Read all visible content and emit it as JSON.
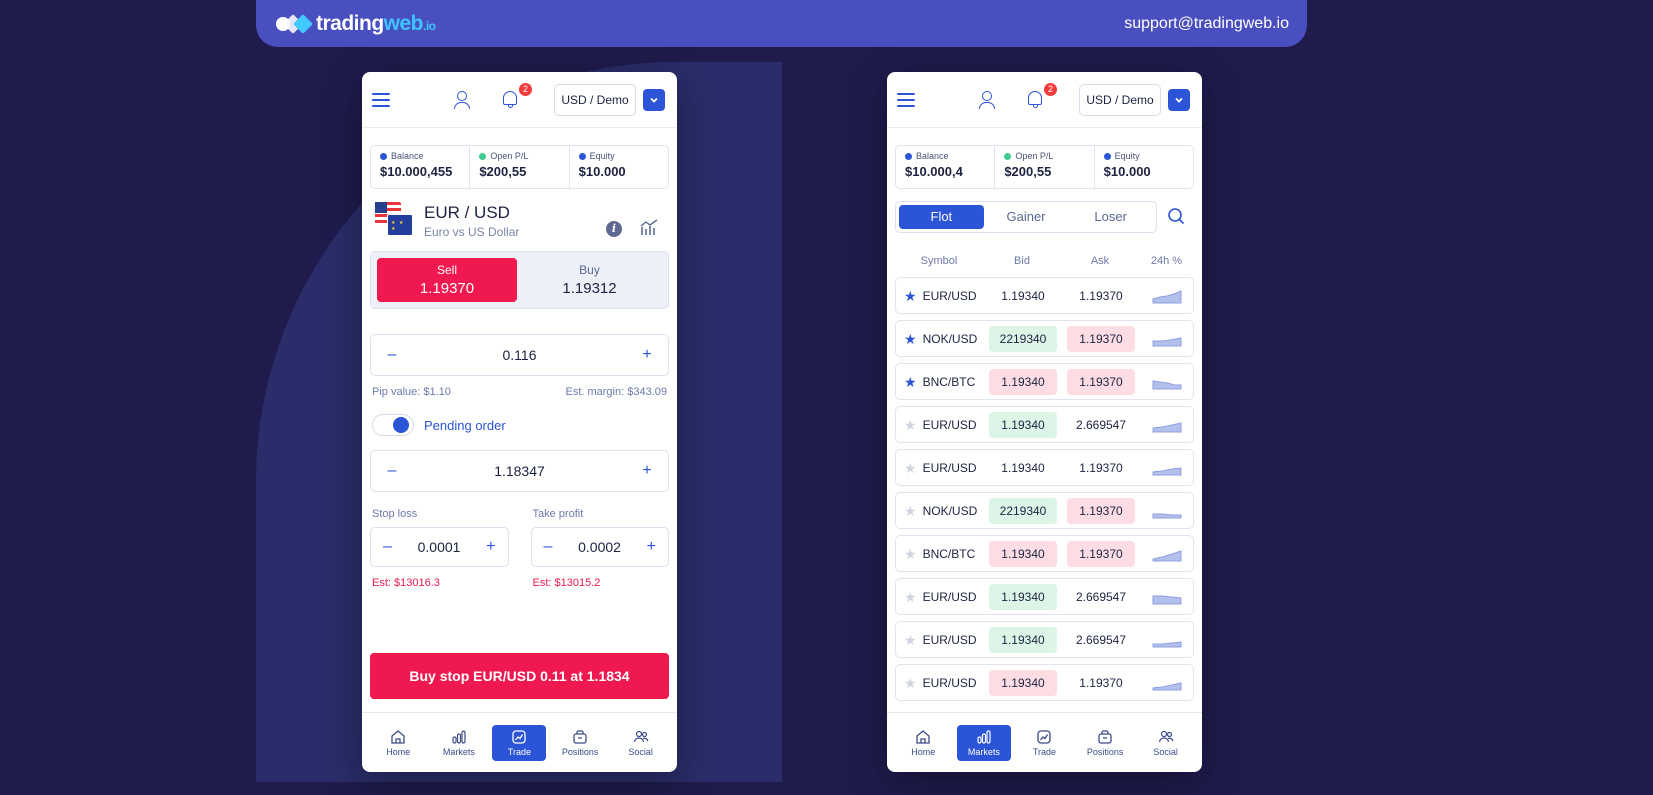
{
  "brand": {
    "name_a": "trading",
    "name_b": "web",
    "name_c": ".io",
    "support_email": "support@tradingweb.io"
  },
  "account": {
    "selector": "USD / Demo",
    "notifications": "2"
  },
  "stats_left": [
    {
      "label": "Balance",
      "value": "$10.000,455",
      "color": "#2c54d6"
    },
    {
      "label": "Open P/L",
      "value": "$200,55",
      "color": "#3dcc8c"
    },
    {
      "label": "Equity",
      "value": "$10.000",
      "color": "#2c54d6"
    }
  ],
  "stats_right": [
    {
      "label": "Balance",
      "value": "$10.000,4",
      "color": "#2c54d6"
    },
    {
      "label": "Open P/L",
      "value": "$200,55",
      "color": "#3dcc8c"
    },
    {
      "label": "Equity",
      "value": "$10.000",
      "color": "#2c54d6"
    }
  ],
  "trade": {
    "pair": "EUR / USD",
    "pair_desc": "Euro vs US Dollar",
    "sell_label": "Sell",
    "sell_price": "1.19370",
    "buy_label": "Buy",
    "buy_price": "1.19312",
    "amount": "0.116",
    "minus": "–",
    "plus": "+",
    "pip_value": "Pip value: $1.10",
    "est_margin": "Est. margin: $343.09",
    "pending_label": "Pending order",
    "pending_price": "1.18347",
    "stop_loss_label": "Stop loss",
    "stop_loss_value": "0.0001",
    "stop_loss_est": "Est: $13016.3",
    "take_profit_label": "Take profit",
    "take_profit_value": "0.0002",
    "take_profit_est": "Est: $13015.2",
    "order_button": "Buy stop EUR/USD 0.11 at 1.1834"
  },
  "tabs": [
    {
      "label": "Home",
      "icon": "home-icon"
    },
    {
      "label": "Markets",
      "icon": "markets-icon"
    },
    {
      "label": "Trade",
      "icon": "trade-icon"
    },
    {
      "label": "Positions",
      "icon": "positions-icon"
    },
    {
      "label": "Social",
      "icon": "social-icon"
    }
  ],
  "markets": {
    "filters": [
      "Flot",
      "Gainer",
      "Loser"
    ],
    "active_filter": "Flot",
    "columns": [
      "Symbol",
      "Bid",
      "Ask",
      "24h %"
    ],
    "rows": [
      {
        "symbol": "EUR/USD",
        "bid": "1.19340",
        "ask": "1.19370",
        "fav": true,
        "bid_tone": "",
        "ask_tone": ""
      },
      {
        "symbol": "NOK/USD",
        "bid": "2219340",
        "ask": "1.19370",
        "fav": true,
        "bid_tone": "g",
        "ask_tone": "r"
      },
      {
        "symbol": "BNC/BTC",
        "bid": "1.19340",
        "ask": "1.19370",
        "fav": true,
        "bid_tone": "r",
        "ask_tone": "r"
      },
      {
        "symbol": "EUR/USD",
        "bid": "1.19340",
        "ask": "2.669547",
        "fav": false,
        "bid_tone": "g",
        "ask_tone": ""
      },
      {
        "symbol": "EUR/USD",
        "bid": "1.19340",
        "ask": "1.19370",
        "fav": false,
        "bid_tone": "",
        "ask_tone": ""
      },
      {
        "symbol": "NOK/USD",
        "bid": "2219340",
        "ask": "1.19370",
        "fav": false,
        "bid_tone": "g",
        "ask_tone": "r"
      },
      {
        "symbol": "BNC/BTC",
        "bid": "1.19340",
        "ask": "1.19370",
        "fav": false,
        "bid_tone": "r",
        "ask_tone": "r"
      },
      {
        "symbol": "EUR/USD",
        "bid": "1.19340",
        "ask": "2.669547",
        "fav": false,
        "bid_tone": "g",
        "ask_tone": ""
      },
      {
        "symbol": "EUR/USD",
        "bid": "1.19340",
        "ask": "2.669547",
        "fav": false,
        "bid_tone": "g",
        "ask_tone": ""
      },
      {
        "symbol": "EUR/USD",
        "bid": "1.19340",
        "ask": "1.19370",
        "fav": false,
        "bid_tone": "r",
        "ask_tone": ""
      }
    ]
  },
  "colors": {
    "accent": "#2c54d6",
    "sell": "#f0194f",
    "background": "#1f1b4d",
    "header": "#4a4fc0"
  }
}
